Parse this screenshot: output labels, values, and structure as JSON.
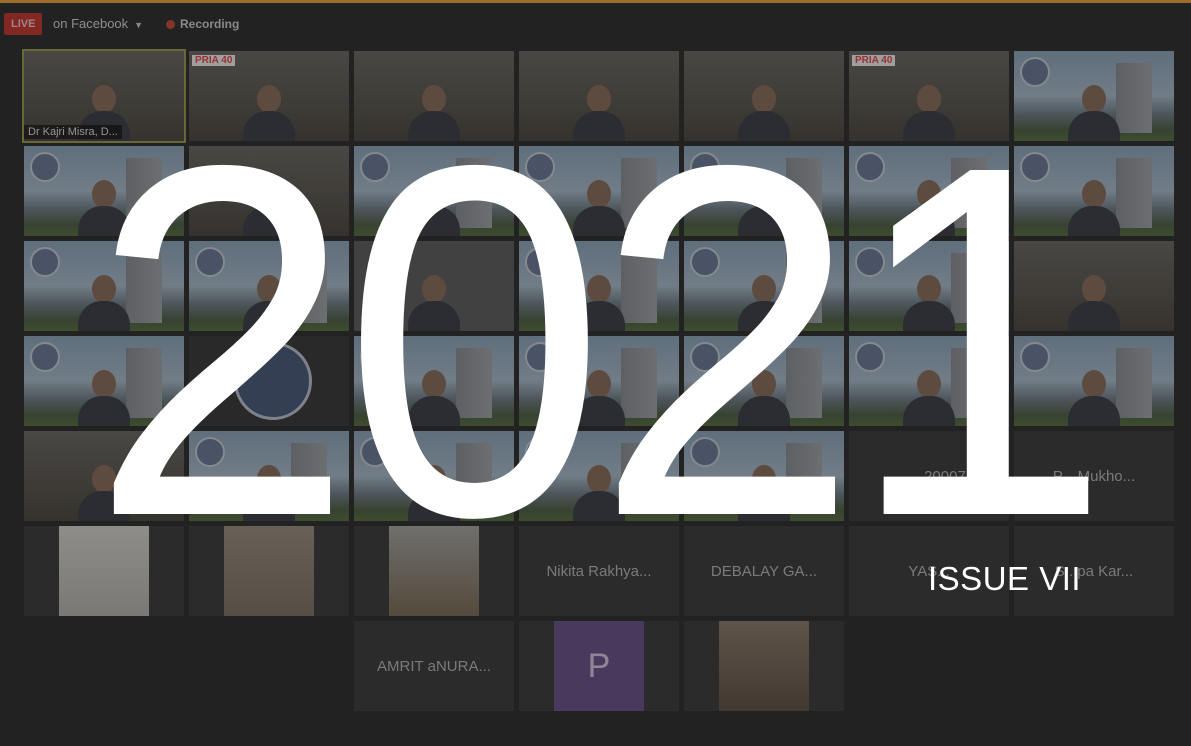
{
  "toolbar": {
    "live_badge": "LIVE",
    "stream_target": "on Facebook",
    "recording_label": "Recording",
    "icons": {
      "dropdown": "chevron-down-icon",
      "recording": "record-dot-icon"
    }
  },
  "colors": {
    "accent_bar": "#f0a33a",
    "live_red": "#c7332d",
    "record_red": "#c9473e",
    "avatar_purple": "#6a4f88"
  },
  "participants": [
    {
      "name_tag": "Dr Kajri Misra, D...",
      "kind": "video",
      "active": true
    },
    {
      "name_tag": "",
      "kind": "video"
    },
    {
      "name_tag": "",
      "kind": "video"
    },
    {
      "name_tag": "",
      "kind": "video"
    },
    {
      "name_tag": "",
      "kind": "video"
    },
    {
      "name_tag": "",
      "kind": "video"
    },
    {
      "name_tag": "",
      "kind": "video"
    }
  ],
  "labeled_tiles": {
    "t20007": "20007_L...",
    "mukho": "P... Mukho...",
    "nikita": "Nikita Rakhya...",
    "debalay": "DEBALAY GA...",
    "yas": "YAS...",
    "sutapa": "S...pa Kar...",
    "amrit": "AMRIT aNURA...",
    "p_initial": "P"
  },
  "cover": {
    "year": "2021",
    "issue": "ISSUE VII"
  }
}
